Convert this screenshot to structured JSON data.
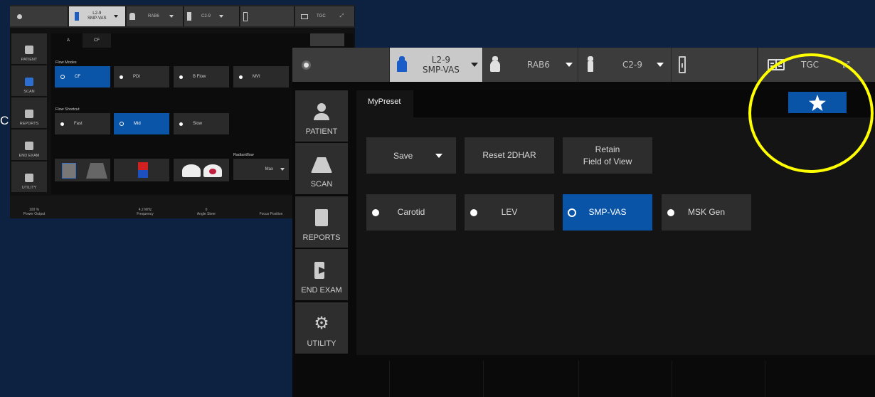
{
  "background_screen": {
    "probes": [
      {
        "name": "L2-9",
        "preset": "SMP-VAS"
      },
      {
        "name": "RAB6"
      },
      {
        "name": "C2-9"
      }
    ],
    "tgc": "TGC",
    "tabs": [
      "A",
      "CF"
    ],
    "sidebar": [
      "PATIENT",
      "SCAN",
      "REPORTS",
      "END EXAM",
      "UTILITY"
    ],
    "flow_modes_label": "Flow Modes",
    "flow_modes": [
      "CF",
      "PDI",
      "B Flow",
      "MVI"
    ],
    "flow_shortcut_label": "Flow Shortcut",
    "flow_shortcuts": [
      "Fast",
      "Mid",
      "Slow"
    ],
    "radiantflow_label": "Radiantflow",
    "radiantflow_value": "Max",
    "bottom": [
      {
        "value": "100 %",
        "label": "Power Output"
      },
      {
        "value": "4.2 MHz",
        "label": "Frequency"
      },
      {
        "value": "0",
        "label": "Angle Steer"
      },
      {
        "value": "",
        "label": "Focus Position"
      }
    ]
  },
  "cut_text": "C",
  "main_screen": {
    "probes": [
      {
        "name": "L2-9",
        "preset": "SMP-VAS",
        "selected": true
      },
      {
        "name": "RAB6"
      },
      {
        "name": "C2-9"
      }
    ],
    "tgc_label": "TGC",
    "sidebar": {
      "items": [
        {
          "label": "PATIENT",
          "icon": "patient-icon"
        },
        {
          "label": "SCAN",
          "icon": "scan-icon"
        },
        {
          "label": "REPORTS",
          "icon": "reports-icon"
        },
        {
          "label": "END EXAM",
          "icon": "end-exam-icon"
        },
        {
          "label": "UTILITY",
          "icon": "utility-icon"
        }
      ]
    },
    "tab": "MyPreset",
    "actions": {
      "save": "Save",
      "reset": "Reset 2DHAR",
      "retain_line1": "Retain",
      "retain_line2": "Field of View"
    },
    "presets": [
      {
        "label": "Carotid",
        "selected": false
      },
      {
        "label": "LEV",
        "selected": false
      },
      {
        "label": "SMP-VAS",
        "selected": true
      },
      {
        "label": "MSK Gen",
        "selected": false
      }
    ]
  },
  "colors": {
    "accent": "#0a54a8",
    "highlight": "#ffff00",
    "backdrop": "#0c2240"
  }
}
